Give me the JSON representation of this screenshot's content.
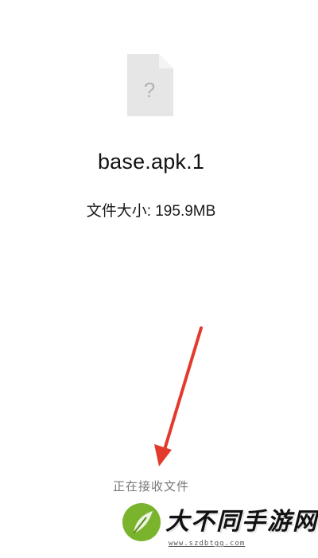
{
  "file": {
    "name": "base.apk.1",
    "size_text": "文件大小: 195.9MB",
    "icon": "unknown-file-icon",
    "icon_glyph": "?"
  },
  "status": {
    "text": "正在接收文件"
  },
  "annotation": {
    "arrow_color": "#e23b2e"
  },
  "watermark": {
    "title": "大不同手游网",
    "url": "www.szdbtgg.com",
    "accent_color": "#f05a1a",
    "logo_color": "#7ab42c"
  }
}
